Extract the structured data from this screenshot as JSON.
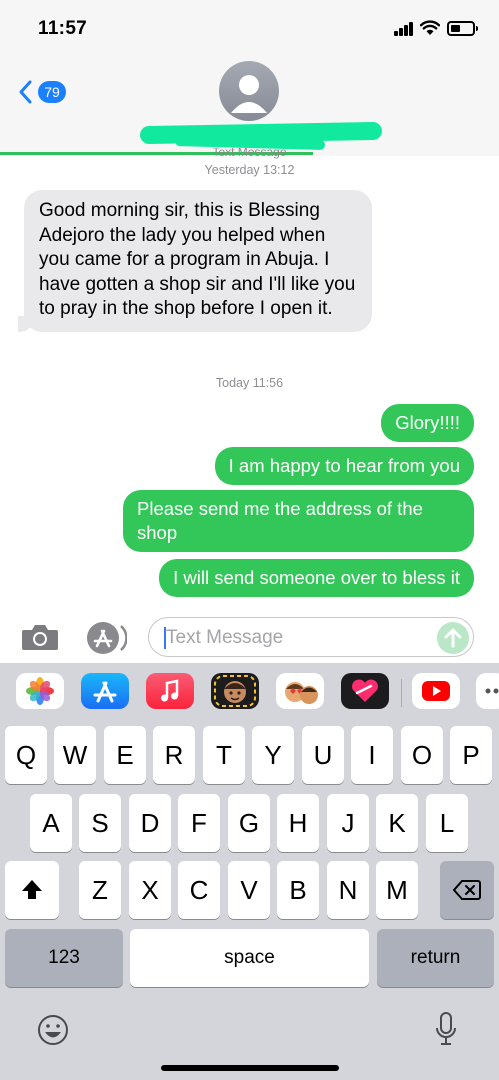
{
  "status_bar": {
    "time": "11:57"
  },
  "header": {
    "back_count": "79",
    "conversation_label": "Text Message"
  },
  "colors": {
    "accent": "#1a80ff",
    "sent_bubble": "#33c759",
    "received_bubble": "#e9e9eb",
    "redaction": "#11ea9e"
  },
  "messages": {
    "timestamp_1": "Yesterday 13:12",
    "received_1": "Good morning sir, this is Blessing Adejoro the lady you helped when you came for a program in Abuja. I have gotten a shop sir and I'll like you to pray  in the shop before I open it.",
    "timestamp_2": "Today 11:56",
    "sent": [
      "Glory!!!!",
      "I am happy to hear from you",
      "Please send me the address of the shop",
      "I will send someone over to bless it"
    ]
  },
  "input": {
    "placeholder": "Text Message"
  },
  "app_strip": [
    "photos-icon",
    "app-store-icon",
    "music-icon",
    "memoji-icon",
    "memoji-stickers-icon",
    "digital-touch-icon",
    "youtube-icon",
    "more-icon"
  ],
  "keyboard": {
    "row1": [
      "Q",
      "W",
      "E",
      "R",
      "T",
      "Y",
      "U",
      "I",
      "O",
      "P"
    ],
    "row2": [
      "A",
      "S",
      "D",
      "F",
      "G",
      "H",
      "J",
      "K",
      "L"
    ],
    "row3": [
      "Z",
      "X",
      "C",
      "V",
      "B",
      "N",
      "M"
    ],
    "numbers_key": "123",
    "space_key": "space",
    "return_key": "return"
  }
}
